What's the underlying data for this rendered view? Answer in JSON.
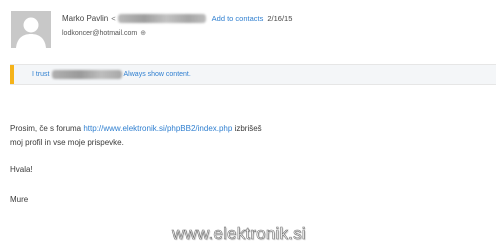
{
  "header": {
    "sender_name": "Marko Pavlin",
    "sender_email_open": "<",
    "add_to_contacts_label": "Add to contacts",
    "date": "2/16/15",
    "recipient": "lodkoncer@hotmail.com",
    "recipient_mark": "⊕"
  },
  "trust_bar": {
    "prefix": "I trust",
    "show_content_label": "Always show content."
  },
  "body": {
    "line1_text": "Prosim, če s foruma ",
    "line1_link": "http://www.elektronik.si/phpBB2/index.php",
    "line1_suffix": " izbrišeš",
    "line2": "moj profil in vse moje prispevke.",
    "line3": "Hvala!",
    "line4": "Mure"
  },
  "watermark": "www.elektronik.si",
  "colors": {
    "link": "#2f7fd0",
    "accent": "#f5b31a",
    "avatar_bg": "#c8c8c8"
  }
}
